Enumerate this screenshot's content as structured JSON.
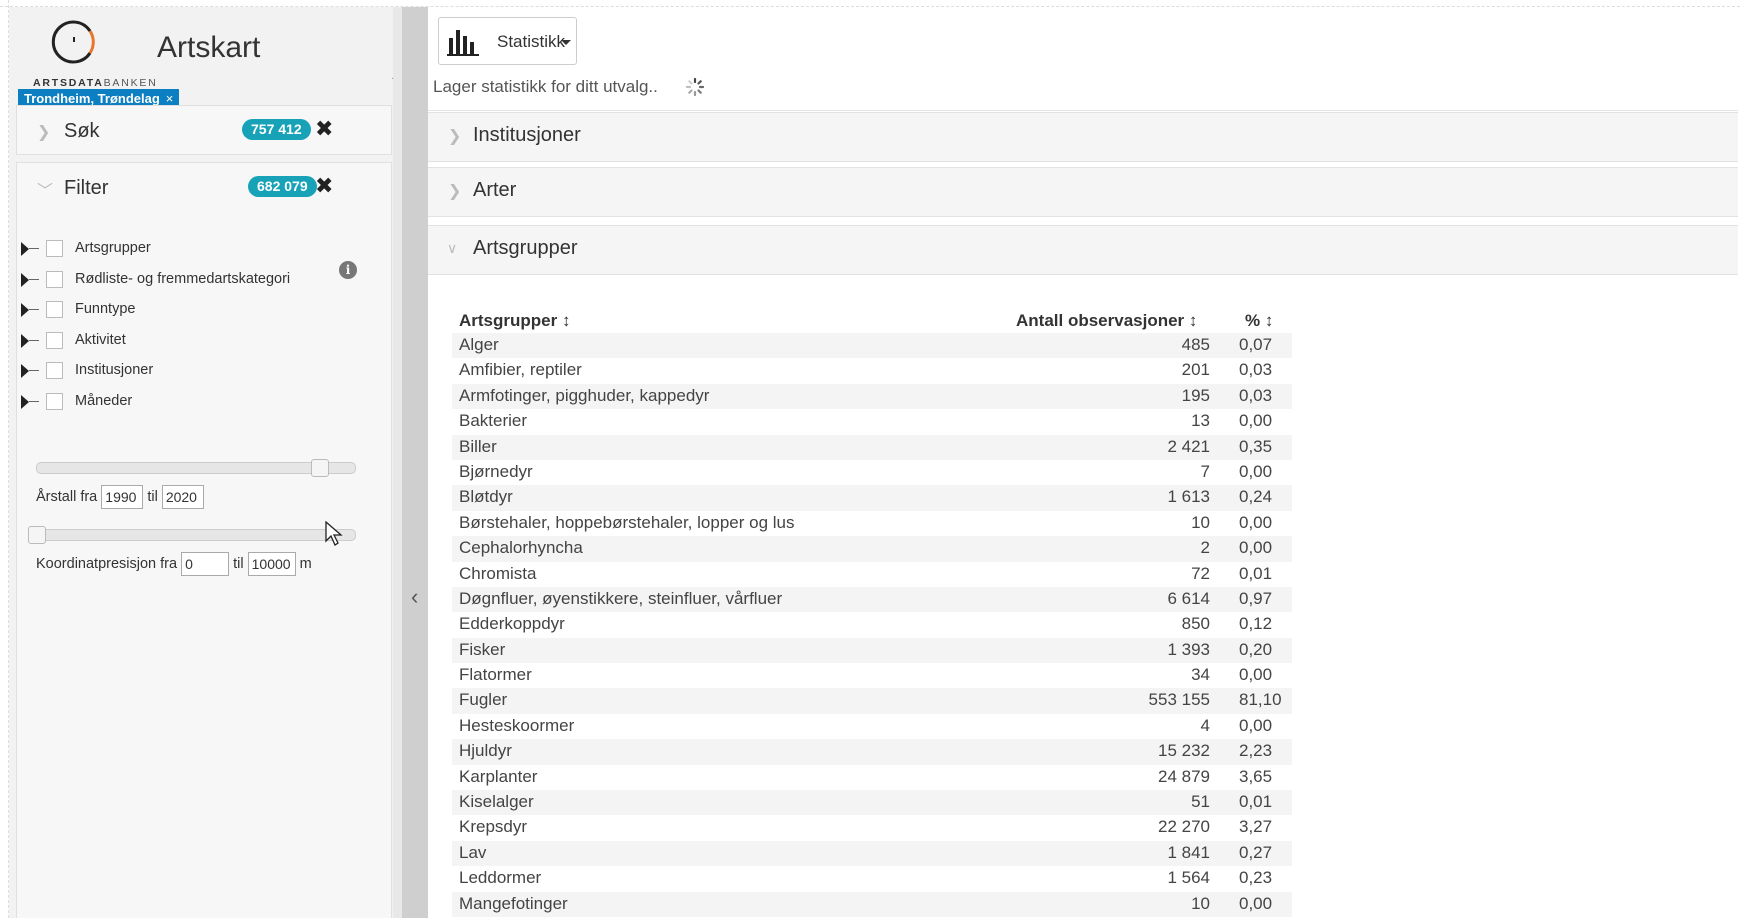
{
  "app": {
    "title": "Artskart",
    "logo_bold": "ARTSDATA",
    "logo_light": "BANKEN"
  },
  "location_chip": {
    "label": "Trondheim, Trøndelag",
    "remove": "×"
  },
  "search_panel": {
    "title": "Søk",
    "count": "757 412",
    "close": "✖"
  },
  "filter_panel": {
    "title": "Filter",
    "count": "682 079",
    "close": "✖",
    "tree": [
      {
        "label": "Artsgrupper"
      },
      {
        "label": "Rødliste- og fremmedartskategori"
      },
      {
        "label": "Funntype"
      },
      {
        "label": "Aktivitet"
      },
      {
        "label": "Institusjoner"
      },
      {
        "label": "Måneder"
      }
    ],
    "year_range": {
      "label_from": "Årstall fra",
      "from": "1990",
      "label_to": "til",
      "to": "2020"
    },
    "coord_range": {
      "label_from": "Koordinatpresisjon fra",
      "from": "0",
      "label_to": "til",
      "to": "10000",
      "unit": "m"
    }
  },
  "toolbar": {
    "statistics_label": "Statistikk"
  },
  "status": {
    "loading_text": "Lager statistikk for ditt utvalg.."
  },
  "accordion": [
    {
      "title": "Institusjoner",
      "expanded": false
    },
    {
      "title": "Arter",
      "expanded": false
    },
    {
      "title": "Artsgrupper",
      "expanded": true
    }
  ],
  "stats_table": {
    "headers": {
      "group": "Artsgrupper",
      "count": "Antall observasjoner",
      "pct": "%"
    },
    "sort_icon": "sort-icon",
    "rows": [
      {
        "name": "Alger",
        "count": "485",
        "pct": "0,07"
      },
      {
        "name": "Amfibier, reptiler",
        "count": "201",
        "pct": "0,03"
      },
      {
        "name": "Armfotinger, pigghuder, kappedyr",
        "count": "195",
        "pct": "0,03"
      },
      {
        "name": "Bakterier",
        "count": "13",
        "pct": "0,00"
      },
      {
        "name": "Biller",
        "count": "2 421",
        "pct": "0,35"
      },
      {
        "name": "Bjørnedyr",
        "count": "7",
        "pct": "0,00"
      },
      {
        "name": "Bløtdyr",
        "count": "1 613",
        "pct": "0,24"
      },
      {
        "name": "Børstehaler, hoppebørstehaler, lopper og lus",
        "count": "10",
        "pct": "0,00"
      },
      {
        "name": "Cephalorhyncha",
        "count": "2",
        "pct": "0,00"
      },
      {
        "name": "Chromista",
        "count": "72",
        "pct": "0,01"
      },
      {
        "name": "Døgnfluer, øyenstikkere, steinfluer, vårfluer",
        "count": "6 614",
        "pct": "0,97"
      },
      {
        "name": "Edderkoppdyr",
        "count": "850",
        "pct": "0,12"
      },
      {
        "name": "Fisker",
        "count": "1 393",
        "pct": "0,20"
      },
      {
        "name": "Flatormer",
        "count": "34",
        "pct": "0,00"
      },
      {
        "name": "Fugler",
        "count": "553 155",
        "pct": "81,10"
      },
      {
        "name": "Hesteskoormer",
        "count": "4",
        "pct": "0,00"
      },
      {
        "name": "Hjuldyr",
        "count": "15 232",
        "pct": "2,23"
      },
      {
        "name": "Karplanter",
        "count": "24 879",
        "pct": "3,65"
      },
      {
        "name": "Kiselalger",
        "count": "51",
        "pct": "0,01"
      },
      {
        "name": "Krepsdyr",
        "count": "22 270",
        "pct": "3,27"
      },
      {
        "name": "Lav",
        "count": "1 841",
        "pct": "0,27"
      },
      {
        "name": "Leddormer",
        "count": "1 564",
        "pct": "0,23"
      },
      {
        "name": "Mangefotinger",
        "count": "10",
        "pct": "0,00"
      }
    ]
  },
  "colors": {
    "badge": "#17a2b8",
    "chip": "#0b7fc1",
    "sidebar_bg": "#f2f2f2",
    "row_stripe": "#f4f4f4"
  }
}
